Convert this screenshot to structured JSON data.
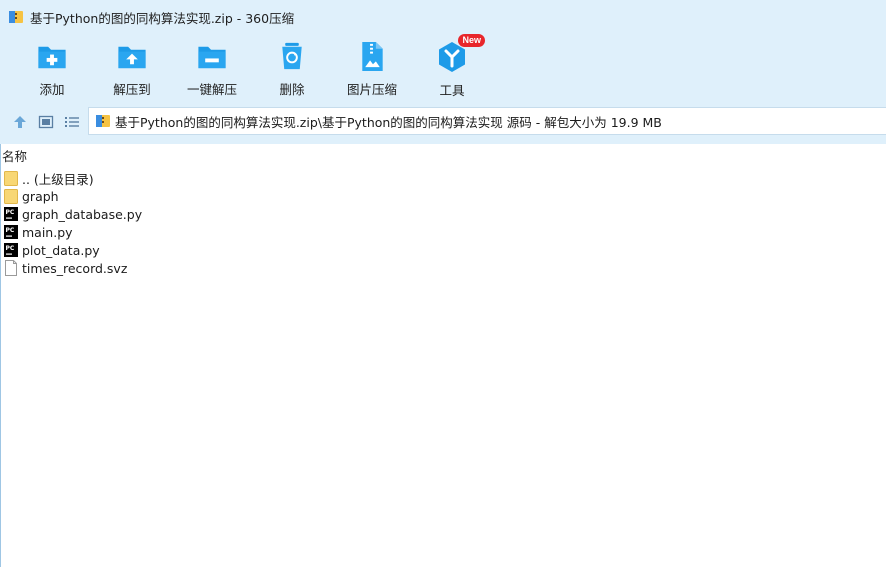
{
  "window": {
    "title": "基于Python的图的同构算法实现.zip - 360压缩"
  },
  "toolbar": {
    "items": [
      {
        "label": "添加",
        "icon": "add-folder-icon"
      },
      {
        "label": "解压到",
        "icon": "extract-to-icon"
      },
      {
        "label": "一键解压",
        "icon": "one-click-extract-icon"
      },
      {
        "label": "删除",
        "icon": "recycle-delete-icon"
      },
      {
        "label": "图片压缩",
        "icon": "image-compress-icon"
      },
      {
        "label": "工具",
        "icon": "tools-icon",
        "badge": "New"
      }
    ]
  },
  "nav": {
    "path": "基于Python的图的同构算法实现.zip\\基于Python的图的同构算法实现 源码 - 解包大小为 19.9 MB"
  },
  "list": {
    "column_name": "名称",
    "files": [
      {
        "name": ".. (上级目录)",
        "type": "folder"
      },
      {
        "name": "graph",
        "type": "folder"
      },
      {
        "name": "graph_database.py",
        "type": "pycharm"
      },
      {
        "name": "main.py",
        "type": "pycharm"
      },
      {
        "name": "plot_data.py",
        "type": "pycharm"
      },
      {
        "name": "times_record.svz",
        "type": "file"
      }
    ]
  },
  "colors": {
    "chrome_bg": "#dff0fb",
    "accent_blue": "#1e9be8",
    "badge_red": "#e8262b",
    "folder_yellow": "#f8d775"
  }
}
